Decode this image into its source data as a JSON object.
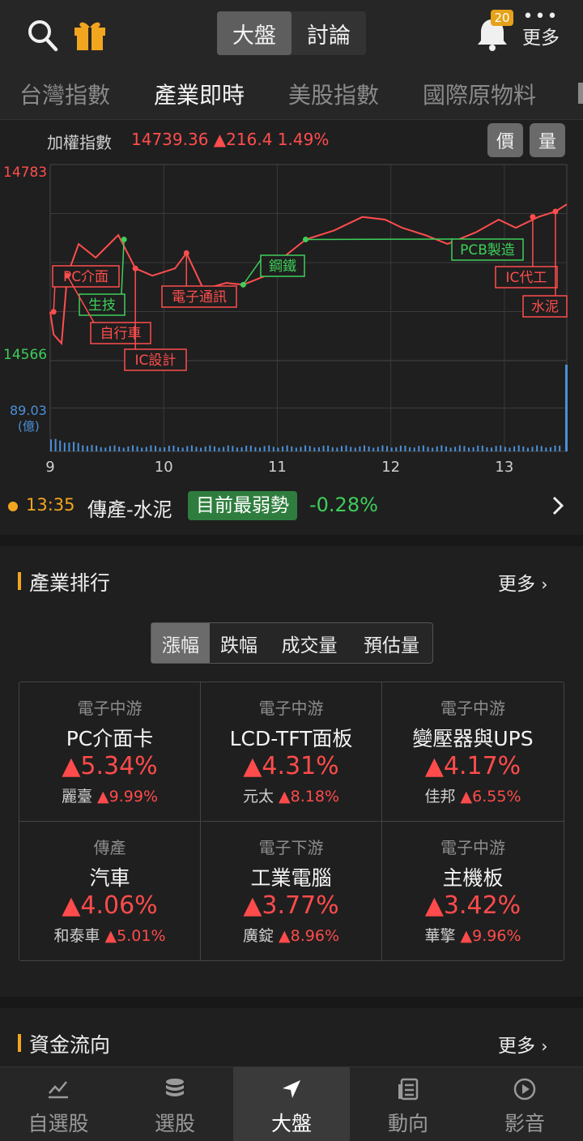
{
  "header": {
    "tabs": [
      "大盤",
      "討論"
    ],
    "active_tab": 0,
    "notification_count": "20",
    "more_label": "更多",
    "icons": [
      "search-icon",
      "gift-icon",
      "bell-icon",
      "more-dots-icon"
    ]
  },
  "subtabs": {
    "items": [
      "台灣指數",
      "產業即時",
      "美股指數",
      "國際原物料"
    ],
    "active": 1
  },
  "index": {
    "label": "加權指數",
    "value_text": "14739.36 ▲216.4 1.49%",
    "btn_price": "價",
    "btn_volume": "量"
  },
  "chart_data": {
    "type": "line",
    "x_ticks": [
      "9",
      "10",
      "11",
      "12",
      "13"
    ],
    "y_max_label": "14783",
    "y_min_label": "14566",
    "volume_max_label": "89.03",
    "volume_unit": "(億)",
    "ylim": [
      14566,
      14783
    ],
    "series": [
      {
        "x": [
          9.0,
          9.03,
          9.1,
          9.15,
          9.25,
          9.4,
          9.6,
          9.75,
          9.9,
          10.1,
          10.2,
          10.35,
          10.55,
          10.7,
          10.9,
          11.05,
          11.25,
          11.5,
          11.75,
          11.95,
          12.1,
          12.3,
          12.5,
          12.75,
          12.95,
          13.1,
          13.3,
          13.45,
          13.55
        ],
        "values": [
          14620,
          14595,
          14585,
          14660,
          14695,
          14680,
          14705,
          14668,
          14660,
          14668,
          14685,
          14645,
          14652,
          14650,
          14660,
          14680,
          14700,
          14710,
          14725,
          14722,
          14713,
          14705,
          14695,
          14708,
          14722,
          14713,
          14725,
          14731,
          14739
        ]
      }
    ],
    "volume": {
      "max": 89.03,
      "spike_x": 13.55,
      "spike_value": 89.03
    },
    "annotations": [
      {
        "text": "PC介面",
        "x": 9.03,
        "y": 14620,
        "color": "#ff4d4d"
      },
      {
        "text": "生技",
        "x": 9.65,
        "y": 14700,
        "color": "#3ecf5a"
      },
      {
        "text": "自行車",
        "x": 9.15,
        "y": 14660,
        "color": "#ff4d4d"
      },
      {
        "text": "IC設計",
        "x": 9.75,
        "y": 14668,
        "color": "#ff4d4d"
      },
      {
        "text": "電子通訊",
        "x": 10.2,
        "y": 14685,
        "color": "#ff4d4d"
      },
      {
        "text": "鋼鐵",
        "x": 10.7,
        "y": 14650,
        "color": "#3ecf5a"
      },
      {
        "text": "PCB製造",
        "x": 11.25,
        "y": 14700,
        "color": "#3ecf5a"
      },
      {
        "text": "IC代工",
        "x": 13.25,
        "y": 14725,
        "color": "#ff4d4d"
      },
      {
        "text": "水泥",
        "x": 13.45,
        "y": 14731,
        "color": "#ff4d4d"
      }
    ]
  },
  "ticker": {
    "time": "13:35",
    "name": "傳產-水泥",
    "tag": "目前最弱勢",
    "change": "-0.28%"
  },
  "industry": {
    "title": "產業排行",
    "more": "更多",
    "filters": [
      "漲幅",
      "跌幅",
      "成交量",
      "預估量"
    ],
    "active_filter": 0,
    "cells": [
      {
        "cat": "電子中游",
        "name": "PC介面卡",
        "pct": "▲5.34%",
        "stock": "麗臺",
        "stock_pct": "▲9.99%"
      },
      {
        "cat": "電子中游",
        "name": "LCD-TFT面板",
        "pct": "▲4.31%",
        "stock": "元太",
        "stock_pct": "▲8.18%"
      },
      {
        "cat": "電子中游",
        "name": "變壓器與UPS",
        "pct": "▲4.17%",
        "stock": "佳邦",
        "stock_pct": "▲6.55%"
      },
      {
        "cat": "傳產",
        "name": "汽車",
        "pct": "▲4.06%",
        "stock": "和泰車",
        "stock_pct": "▲5.01%"
      },
      {
        "cat": "電子下游",
        "name": "工業電腦",
        "pct": "▲3.77%",
        "stock": "廣錠",
        "stock_pct": "▲8.96%"
      },
      {
        "cat": "電子中游",
        "name": "主機板",
        "pct": "▲3.42%",
        "stock": "華擎",
        "stock_pct": "▲9.96%"
      }
    ]
  },
  "funds": {
    "title": "資金流向",
    "more": "更多"
  },
  "bottom_nav": {
    "items": [
      "自選股",
      "選股",
      "大盤",
      "動向",
      "影音"
    ],
    "active": 2
  },
  "colors": {
    "up": "#ff4d4d",
    "down": "#3ecf5a",
    "accent": "#f2a51f",
    "volume": "#4a90d9"
  }
}
